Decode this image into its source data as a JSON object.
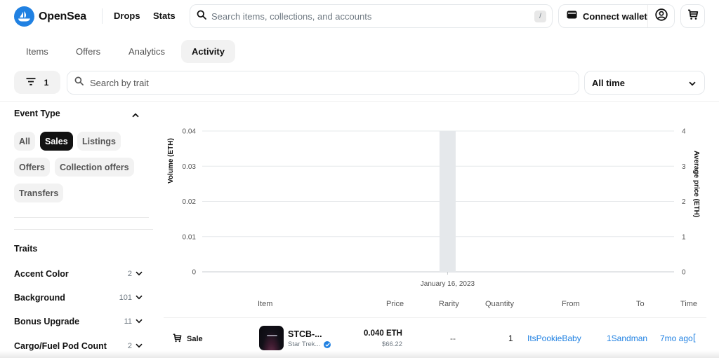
{
  "header": {
    "brand": "OpenSea",
    "nav": [
      "Drops",
      "Stats"
    ],
    "search_placeholder": "Search items, collections, and accounts",
    "search_shortcut": "/",
    "connect_wallet": "Connect wallet",
    "icons": {
      "logo": "opensea-logo-icon",
      "search": "search-icon",
      "wallet": "wallet-icon",
      "profile": "profile-icon",
      "cart": "cart-icon"
    }
  },
  "tabs": [
    {
      "label": "Items",
      "active": false
    },
    {
      "label": "Offers",
      "active": false
    },
    {
      "label": "Analytics",
      "active": false
    },
    {
      "label": "Activity",
      "active": true
    }
  ],
  "filters": {
    "filter_count": "1",
    "trait_search_placeholder": "Search by trait",
    "time_range": "All time"
  },
  "sidebar": {
    "event_type": {
      "title": "Event Type",
      "chips": [
        {
          "label": "All",
          "selected": false
        },
        {
          "label": "Sales",
          "selected": true
        },
        {
          "label": "Listings",
          "selected": false
        },
        {
          "label": "Offers",
          "selected": false
        },
        {
          "label": "Collection offers",
          "selected": false
        },
        {
          "label": "Transfers",
          "selected": false
        }
      ]
    },
    "traits": {
      "title": "Traits",
      "items": [
        {
          "name": "Accent Color",
          "count": "2"
        },
        {
          "name": "Background",
          "count": "101"
        },
        {
          "name": "Bonus Upgrade",
          "count": "11"
        },
        {
          "name": "Cargo/Fuel Pod Count",
          "count": "2"
        }
      ]
    }
  },
  "chart_data": {
    "type": "bar",
    "categories": [
      "January 16, 2023"
    ],
    "series": [
      {
        "name": "Volume (ETH)",
        "axis": "left",
        "values": [
          0.04
        ]
      },
      {
        "name": "Average price (ETH)",
        "axis": "right",
        "values": [
          0.04
        ]
      }
    ],
    "xlabel": "",
    "ylabel": "Volume (ETH)",
    "ylabel_right": "Average price (ETH)",
    "ylim": [
      0,
      0.04
    ],
    "ylim_right": [
      0,
      4
    ],
    "yticks": [
      "0",
      "0.01",
      "0.02",
      "0.03",
      "0.04"
    ],
    "yticks_right": [
      "0",
      "1",
      "2",
      "3",
      "4"
    ],
    "x_position_fraction": 0.52,
    "grid": true,
    "bar_color": "#e5e8eb"
  },
  "table": {
    "columns": [
      "Item",
      "Price",
      "Rarity",
      "Quantity",
      "From",
      "To",
      "Time"
    ],
    "rows": [
      {
        "event": "Sale",
        "item_name": "STCB-...",
        "collection": "Star Trek...",
        "verified": true,
        "price_eth": "0.040 ETH",
        "price_usd": "$66.22",
        "rarity": "--",
        "quantity": "1",
        "from": "ItsPookieBaby",
        "to": "1Sandman",
        "time": "7mo ago"
      }
    ]
  },
  "colors": {
    "accent": "#2081e2",
    "text": "#121212",
    "muted": "#707a83"
  }
}
